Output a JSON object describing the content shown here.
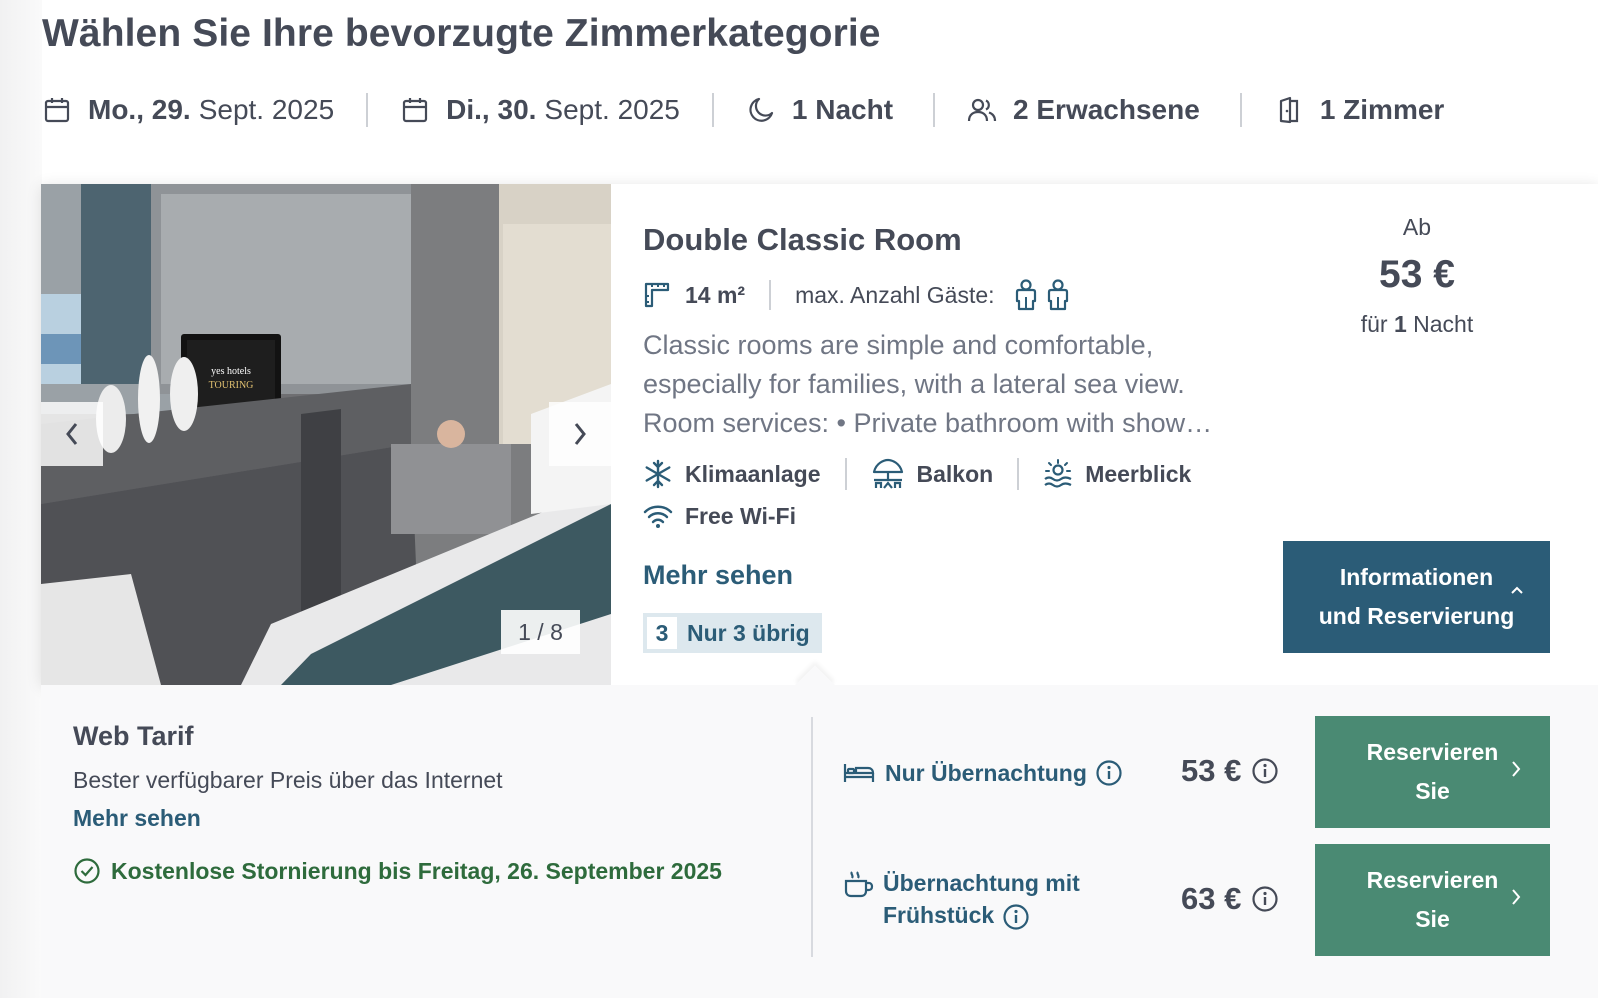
{
  "page_title": "Wählen Sie Ihre bevorzugte Zimmerkategorie",
  "summary": {
    "checkin_day": "Mo., 29.",
    "checkin_rest": "Sept. 2025",
    "checkout_day": "Di., 30.",
    "checkout_rest": "Sept. 2025",
    "nights": "1 Nacht",
    "guests": "2 Erwachsene",
    "rooms": "1 Zimmer"
  },
  "room": {
    "title": "Double Classic Room",
    "size": "14 m²",
    "max_guests_label": "max. Anzahl Gäste:",
    "photo_counter": "1 / 8",
    "photo_tv_text_1": "yes hotels",
    "photo_tv_text_2": "TOURING",
    "description_line1": "Classic rooms are simple and comfortable,",
    "description_line2": "especially for families, with a lateral sea view.",
    "description_line3": "Room services: • Private bathroom with show…",
    "amenities": [
      "Klimaanlage",
      "Balkon",
      "Meerblick",
      "Free Wi-Fi"
    ],
    "more_link": "Mehr sehen",
    "availability_count": "3",
    "availability_text": "Nur 3 übrig",
    "price_prefix": "Ab",
    "price": "53 €",
    "price_per_pre": "für ",
    "price_per_num": "1",
    "price_per_post": " Nacht",
    "info_button_line1": "Informationen",
    "info_button_line2": "und Reservierung"
  },
  "rate": {
    "title": "Web Tarif",
    "description": "Bester verfügbarer Preis über das Internet",
    "more_link": "Mehr sehen",
    "cancellation": "Kostenlose Stornierung bis Freitag, 26. September 2025",
    "options": [
      {
        "label": "Nur Übernachtung",
        "price": "53 €",
        "button_line1": "Reservieren",
        "button_line2": "Sie"
      },
      {
        "label_line1": "Übernachtung mit",
        "label_line2": "Frühstück",
        "price": "63 €",
        "button_line1": "Reservieren",
        "button_line2": "Sie"
      }
    ]
  },
  "colors": {
    "primary": "#2b5c77",
    "reserve": "#4a8a73",
    "success": "#2e6b3c",
    "text": "#454a57"
  }
}
